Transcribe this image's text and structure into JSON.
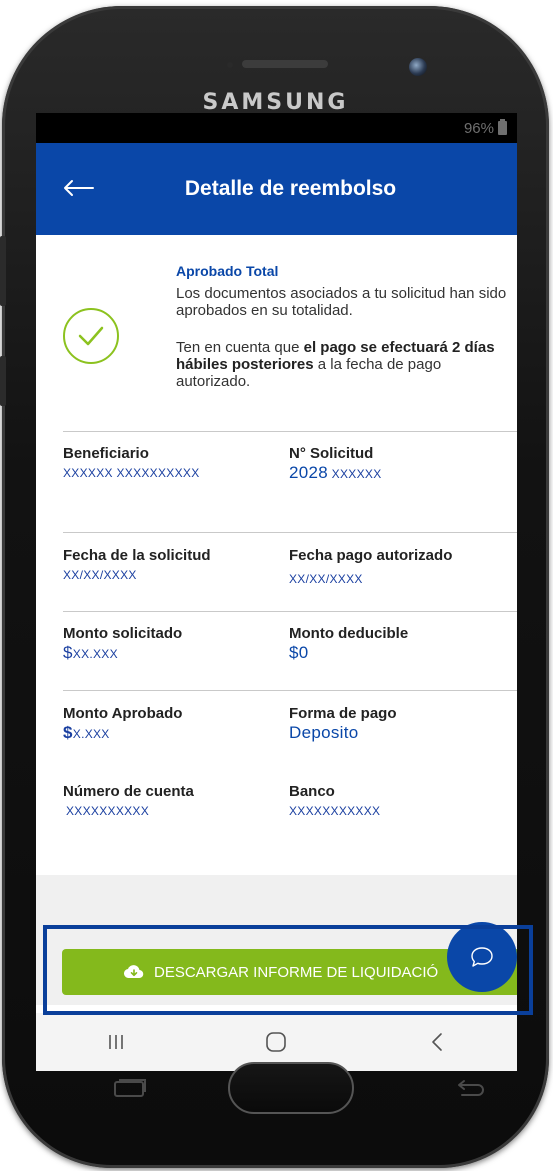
{
  "device": {
    "brand": "SAMSUNG",
    "battery": "96%"
  },
  "header": {
    "title": "Detalle de reembolso"
  },
  "notice": {
    "title": "Aprobado Total",
    "text": "Los documentos asociados a tu solicitud han sido aprobados en su totalidad.",
    "payment_prefix": "Ten en cuenta que ",
    "payment_bold": "el pago se efectuará 2 días hábiles posteriores",
    "payment_suffix": " a la fecha de pago autorizado."
  },
  "fields": {
    "beneficiario": {
      "label": "Beneficiario",
      "value": "XXXXXX XXXXXXXXXX"
    },
    "solicitud": {
      "label": "N° Solicitud",
      "value_prefix": "2028",
      "value_suffix": "XXXXXX"
    },
    "fecha_solicitud": {
      "label": "Fecha de la solicitud",
      "value": "XX/XX/XXXX"
    },
    "fecha_pago": {
      "label": "Fecha pago autorizado",
      "value": "XX/XX/XXXX"
    },
    "monto_solicitado": {
      "label": "Monto solicitado",
      "currency": "$",
      "value": "XX.XXX"
    },
    "monto_deducible": {
      "label": "Monto deducible",
      "value": "$0"
    },
    "monto_aprobado": {
      "label": "Monto Aprobado",
      "currency": "$",
      "value": "X.XXX"
    },
    "forma_pago": {
      "label": "Forma de pago",
      "value": "Deposito"
    },
    "numero_cuenta": {
      "label": "Número de cuenta",
      "value": "XXXXXXXXXX"
    },
    "banco": {
      "label": "Banco",
      "value": "XXXXXXXXXXX"
    }
  },
  "actions": {
    "download_label": "DESCARGAR INFORME DE LIQUIDACIÓ"
  },
  "colors": {
    "primary": "#0a47a8",
    "accent": "#84b91c"
  }
}
